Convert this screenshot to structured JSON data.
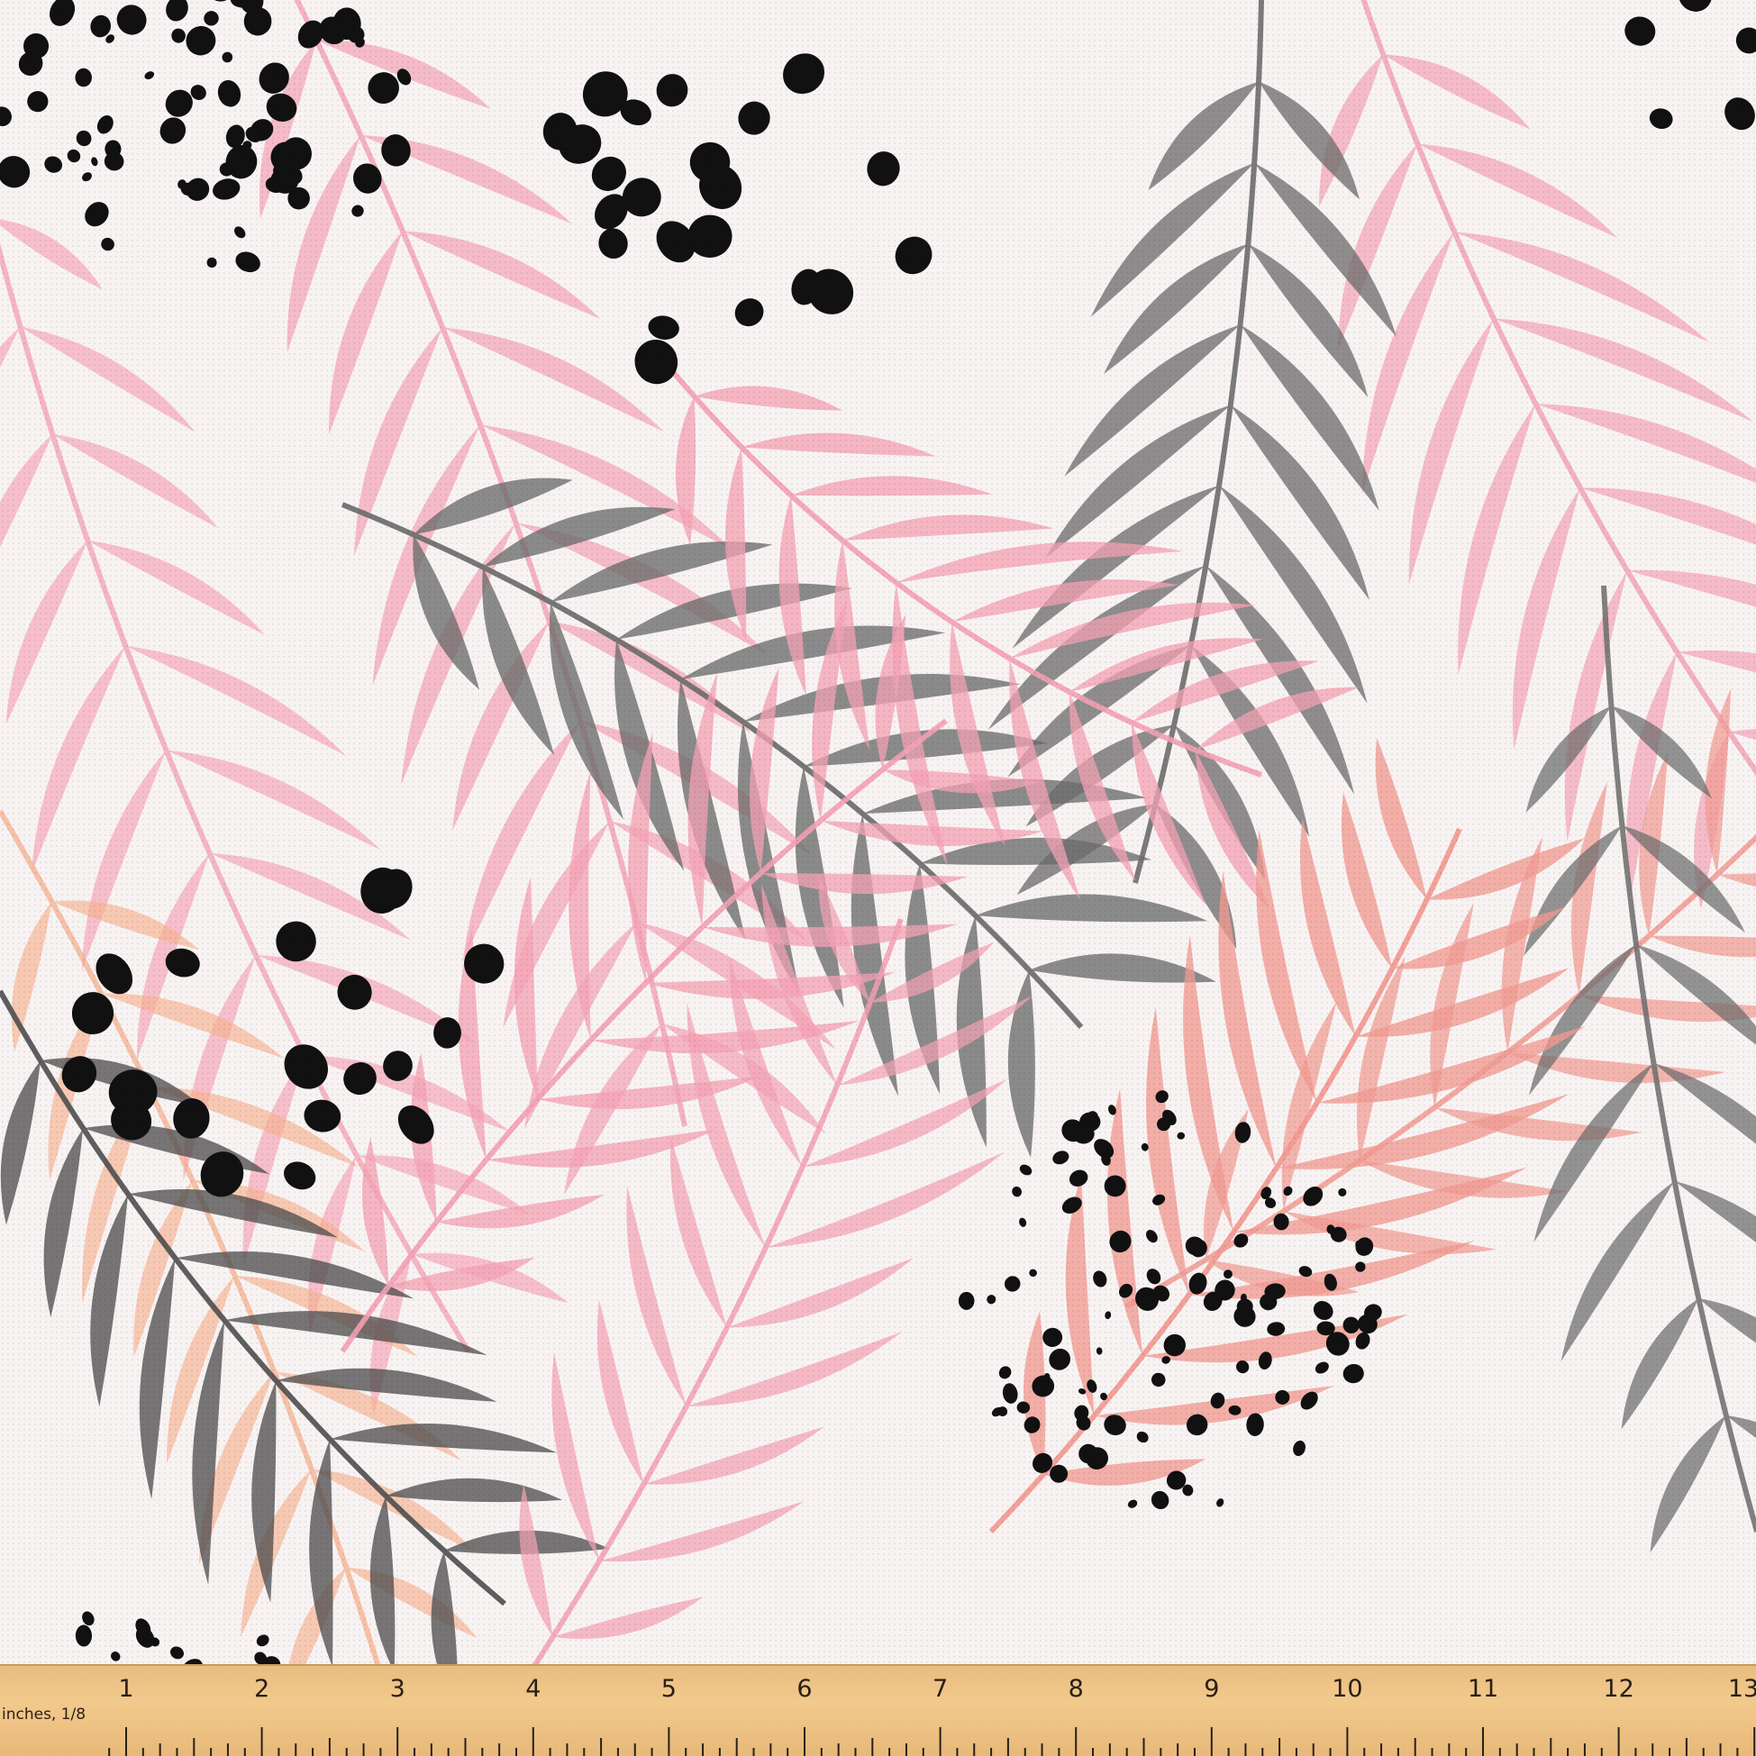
{
  "ruler": {
    "unit_label": "inches, 1/8",
    "numbers": [
      "1",
      "2",
      "3",
      "4",
      "5",
      "6",
      "7",
      "8",
      "9",
      "10",
      "11",
      "12",
      "13"
    ]
  },
  "colors": {
    "background": "#f8f3f3",
    "pink": "#f3a1b4",
    "salmon": "#f19b92",
    "peach": "#f4b08e",
    "gray": "#6c6c6c",
    "dark_gray": "#4e4e4e",
    "dots": "#111111",
    "ruler": "#efc286"
  }
}
